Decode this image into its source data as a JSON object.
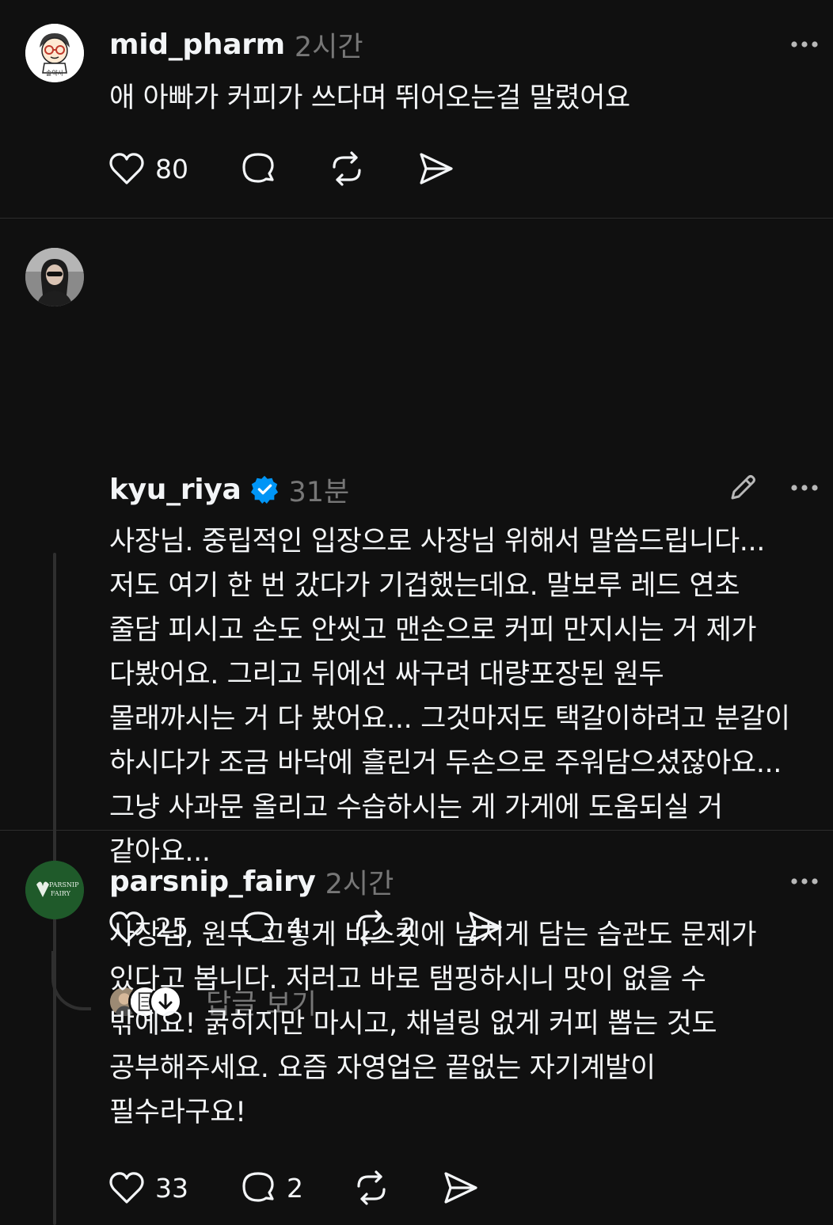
{
  "posts": [
    {
      "username": "mid_pharm",
      "time": "2시간",
      "text_lines": [
        "애 아빠가 커피가 쓰다며 뛰어오는걸 말렸어요"
      ],
      "likes": "80",
      "avatar_caption": "솔약사"
    },
    {
      "username": "kyu_riya",
      "verified": true,
      "time": "31분",
      "text_lines": [
        "사장님. 중립적인 입장으로 사장님 위해서 말씀드립니다...",
        "저도 여기 한 번 갔다가 기겁했는데요. 말보루 레드 연초",
        "줄담 피시고 손도 안씻고 맨손으로 커피 만지시는 거 제가",
        "다봤어요. 그리고 뒤에선 싸구려 대량포장된 원두",
        "몰래까시는 거 다 봤어요... 그것마저도 택갈이하려고 분갈이",
        "하시다가 조금 바닥에 흘린거 두손으로 주워담으셨잖아요...",
        "그냥 사과문 올리고 수습하시는 게 가게에 도움되실 거",
        "같아요..."
      ],
      "likes": "25",
      "comments": "4",
      "reposts": "2",
      "view_replies": "답글 보기"
    },
    {
      "username": "parsnip_fairy",
      "time": "2시간",
      "text_lines": [
        "사장님, 원두 그렇게 바스켓에 넘치게 담는 습관도 문제가",
        "있다고 봅니다. 저러고 바로 탬핑하시니 맛이 없을 수",
        "밖에요! 굵히지만 마시고, 채널링 없게 커피 뽑는 것도",
        "공부해주세요. 요즘 자영업은 끝없는 자기계발이",
        "필수라구요!"
      ],
      "likes": "33",
      "comments": "2",
      "avatar_caption_1": "PARSNIP",
      "avatar_caption_2": "FAIRY"
    }
  ],
  "icons": {
    "like": "heart-icon",
    "comment": "comment-bubble-icon",
    "repost": "repost-icon",
    "share": "send-icon",
    "more": "more-horizontal-icon",
    "edit": "pencil-icon",
    "verified": "verified-badge-icon"
  },
  "colors": {
    "background": "#101010",
    "text": "#f3f5f7",
    "secondary": "#777777",
    "verified": "#0095f6",
    "divider": "#2d2d2d"
  }
}
